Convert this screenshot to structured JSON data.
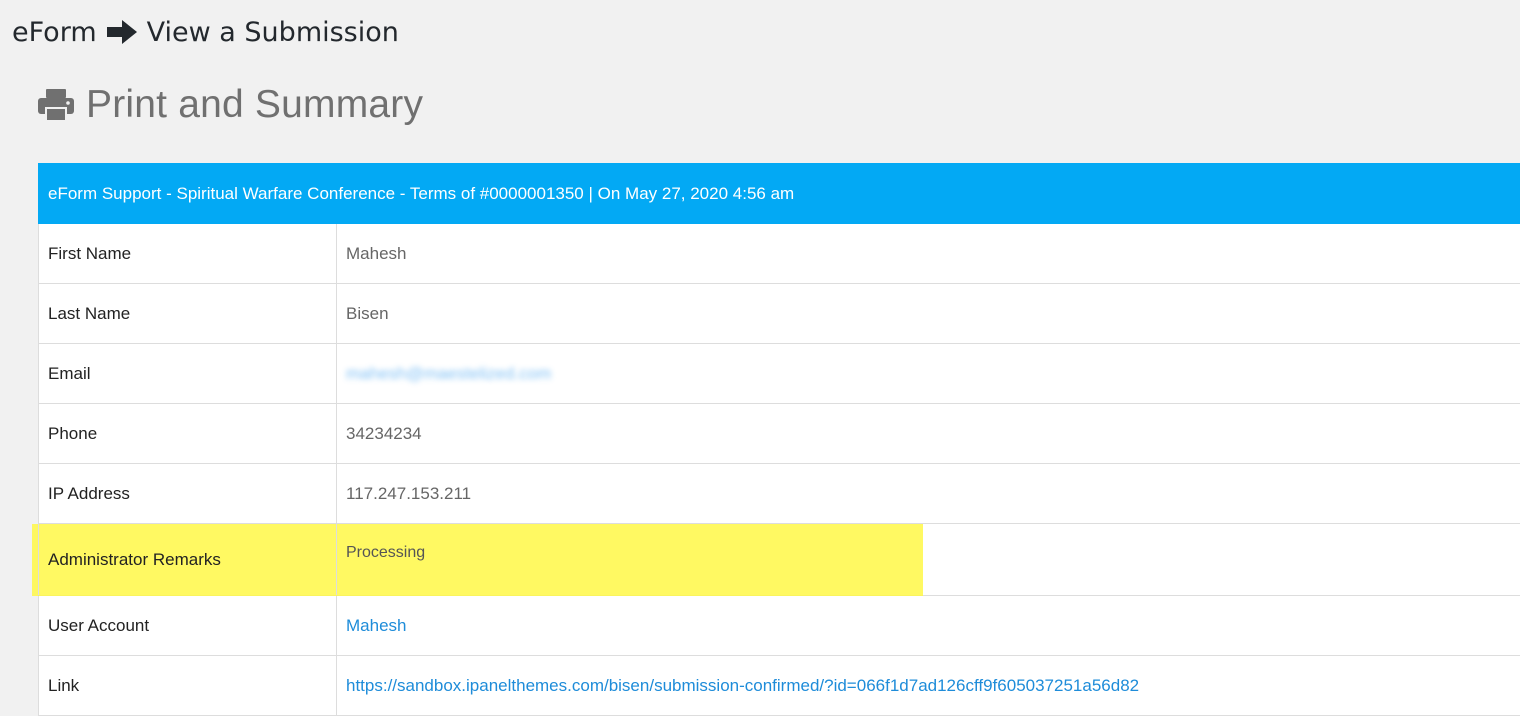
{
  "breadcrumb": {
    "parent": "eForm",
    "arrow_icon": "arrow-right-icon",
    "current": "View a Submission"
  },
  "page_title": {
    "icon": "printer-icon",
    "text": "Print and Summary"
  },
  "submission_table": {
    "header": "eForm Support - Spiritual Warfare Conference - Terms of #0000001350 | On May 27, 2020 4:56 am",
    "rows": [
      {
        "label": "First Name",
        "value": "Mahesh"
      },
      {
        "label": "Last Name",
        "value": "Bisen"
      },
      {
        "label": "Email",
        "value": "mahesh@maestelized.com"
      },
      {
        "label": "Phone",
        "value": "34234234"
      },
      {
        "label": "IP Address",
        "value": "117.247.153.211"
      },
      {
        "label": "Administrator Remarks",
        "value": "Processing"
      },
      {
        "label": "User Account",
        "value": "Mahesh"
      },
      {
        "label": "Link",
        "value": "https://sandbox.ipanelthemes.com/bisen/submission-confirmed/?id=066f1d7ad126cff9f605037251a56d82"
      }
    ]
  },
  "colors": {
    "header_bg": "#03a9f4",
    "link": "#1e8cd9",
    "highlight": "#fff846",
    "page_bg": "#f1f1f1"
  }
}
